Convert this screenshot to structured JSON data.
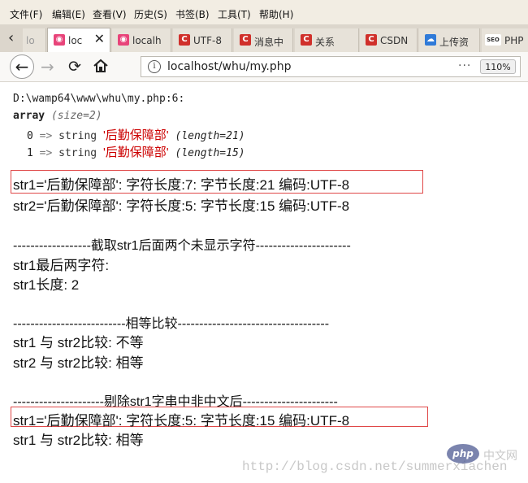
{
  "menu": [
    "文件(F)",
    "编辑(E)",
    "查看(V)",
    "历史(S)",
    "书签(B)",
    "工具(T)",
    "帮助(H)"
  ],
  "tabs": [
    {
      "label": "loc",
      "icon": "ee",
      "color": "#e8447a",
      "active": true
    },
    {
      "label": "localh",
      "icon": "ee",
      "color": "#e8447a"
    },
    {
      "label": "UTF-8",
      "icon": "C",
      "color": "#d0302b"
    },
    {
      "label": "消息中",
      "icon": "C",
      "color": "#d0302b"
    },
    {
      "label": "关系",
      "icon": "C",
      "color": "#d0302b"
    },
    {
      "label": "CSDN",
      "icon": "C",
      "color": "#d0302b"
    },
    {
      "label": "上传资",
      "icon": "☁",
      "color": "#2f7ad8"
    },
    {
      "label": "PHP",
      "icon": "SEO",
      "color": "#555555"
    }
  ],
  "first_tab_label": "lo",
  "url": "localhost/whu/my.php",
  "zoom": "110%",
  "xdebug": {
    "path": "D:\\wamp64\\www\\whu\\my.php:6:",
    "array_kw": "array",
    "size": "(size=2)",
    "rows": [
      {
        "idx": "0",
        "arrow": "=>",
        "type": "string",
        "value": "'后勤保障部'",
        "len": "(length=21)"
      },
      {
        "idx": "1",
        "arrow": "=>",
        "type": "string",
        "value": "'后勤保障部'",
        "len": "(length=15)"
      }
    ]
  },
  "output": {
    "line1": "str1='后勤保障部':    字符长度:7:    字节长度:21    编码:UTF-8",
    "line2": "str2='后勤保障部':    字符长度:5:    字节长度:15    编码:UTF-8",
    "divider1": "------------------截取str1后面两个未显示字符----------------------",
    "line3": "str1最后两字符:",
    "line4": "str1长度:    2",
    "divider2": "--------------------------相等比较-----------------------------------",
    "line5": "str1 与 str2比较:    不等",
    "line6": "str2 与 str2比较:    相等",
    "divider3": "---------------------剔除str1字串中非中文后----------------------",
    "line7": "str1='后勤保障部':    字符长度:5:    字节长度:15    编码:UTF-8",
    "line8": "str1 与 str2比较:    相等"
  },
  "watermark": "http://blog.csdn.net/summerxiachen",
  "logo_text": "php",
  "logo_site": "中文网"
}
